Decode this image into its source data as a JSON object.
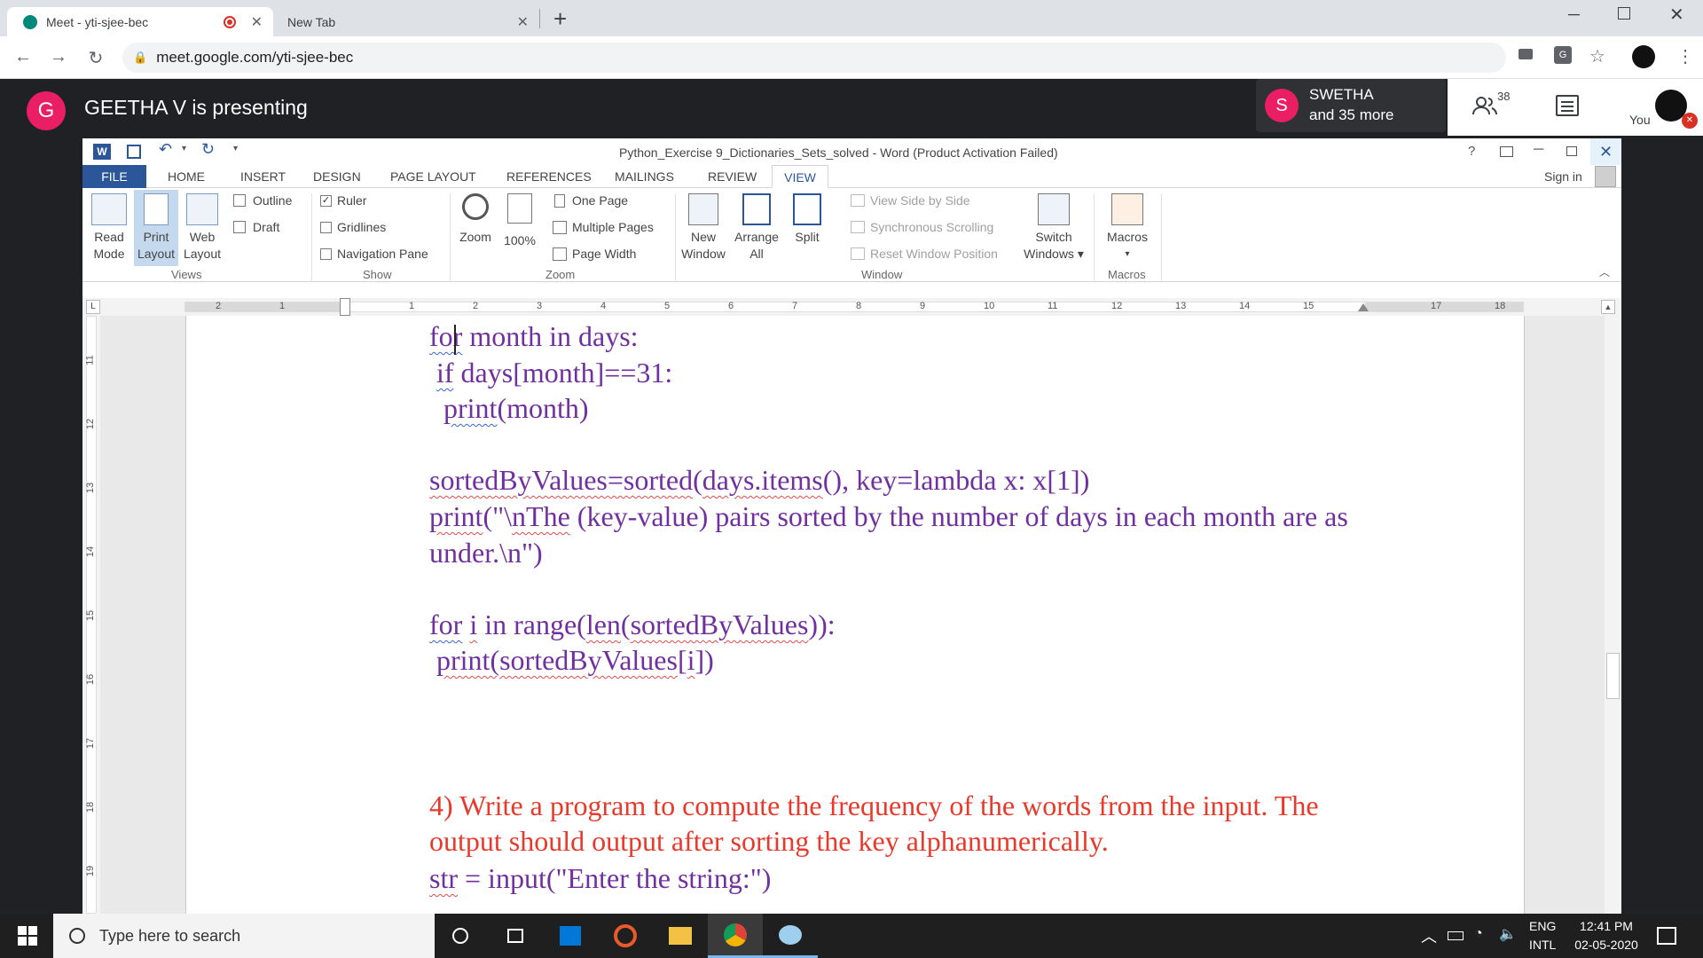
{
  "browser": {
    "tabs": [
      {
        "title": "Meet - yti-sjee-bec",
        "active": true
      },
      {
        "title": "New Tab",
        "active": false
      }
    ],
    "new_tab_symbol": "+",
    "url": "meet.google.com/yti-sjee-bec"
  },
  "meet": {
    "presenter_initial": "G",
    "presenting_text": "GEETHA V is presenting",
    "participant_initial": "S",
    "participant_name": "SWETHA",
    "participant_more": "and 35 more",
    "people_count": "38",
    "you_label": "You",
    "colors": {
      "presenter_avatar": "#e91e63",
      "participant_avatar": "#e91e63"
    }
  },
  "word": {
    "window_title": "Python_Exercise 9_Dictionaries_Sets_solved - Word (Product Activation Failed)",
    "help": "?",
    "tabs": [
      "FILE",
      "HOME",
      "INSERT",
      "DESIGN",
      "PAGE LAYOUT",
      "REFERENCES",
      "MAILINGS",
      "REVIEW",
      "VIEW"
    ],
    "active_tab": "VIEW",
    "sign_in": "Sign in",
    "ribbon": {
      "views": {
        "read_mode": [
          "Read",
          "Mode"
        ],
        "print_layout": [
          "Print",
          "Layout"
        ],
        "web_layout": [
          "Web",
          "Layout"
        ],
        "outline": "Outline",
        "draft": "Draft",
        "group": "Views"
      },
      "show": {
        "ruler": "Ruler",
        "gridlines": "Gridlines",
        "navigation_pane": "Navigation Pane",
        "group": "Show"
      },
      "zoom": {
        "zoom": "Zoom",
        "hundred": "100%",
        "one_page": "One Page",
        "multiple_pages": "Multiple Pages",
        "page_width": "Page Width",
        "group": "Zoom"
      },
      "window": {
        "new_window": [
          "New",
          "Window"
        ],
        "arrange_all": [
          "Arrange",
          "All"
        ],
        "split": "Split",
        "side_by_side": "View Side by Side",
        "sync_scroll": "Synchronous Scrolling",
        "reset_pos": "Reset Window Position",
        "switch": [
          "Switch",
          "Windows ▾"
        ],
        "group": "Window"
      },
      "macros": {
        "macros": "Macros",
        "group": "Macros"
      }
    },
    "ruler_numbers": [
      "2",
      "1",
      "1",
      "2",
      "3",
      "4",
      "5",
      "6",
      "7",
      "8",
      "9",
      "10",
      "11",
      "12",
      "13",
      "14",
      "15",
      "17",
      "18"
    ],
    "vruler_numbers": [
      "11",
      "12",
      "13",
      "14",
      "15",
      "16",
      "17",
      "18",
      "19"
    ],
    "doc_lines": [
      "for month in days:",
      " if days[month]==31:",
      "  print(month)",
      "sortedByValues=sorted(days.items(), key=lambda x: x[1])",
      "print(\"\\nThe (key-value) pairs sorted by the number of days in each month are as",
      "under.\\n\")",
      "for i in range(len(sortedByValues)):",
      " print(sortedByValues[i])",
      "4) Write a program to compute the frequency of the words from the input. The",
      "output should output after sorting the key alphanumerically.",
      "str = input(\"Enter the string:\")"
    ],
    "colors": {
      "code": "#7030a0",
      "question": "#e8392b",
      "accent": "#2b579a"
    }
  },
  "taskbar": {
    "search_placeholder": "Type here to search",
    "lang_top": "ENG",
    "lang_bottom": "INTL",
    "time": "12:41 PM",
    "date": "02-05-2020"
  }
}
